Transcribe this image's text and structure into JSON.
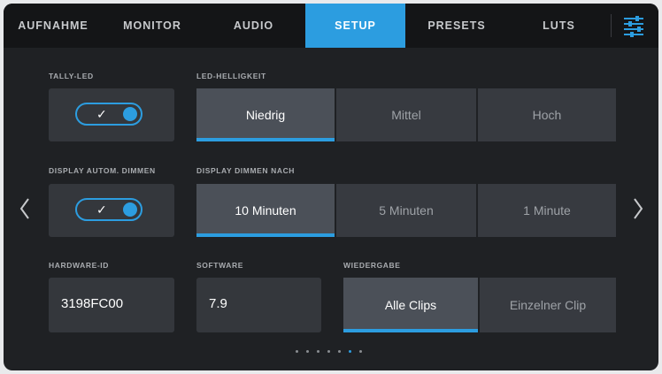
{
  "tabs": [
    {
      "label": "AUFNAHME",
      "active": false
    },
    {
      "label": "MONITOR",
      "active": false
    },
    {
      "label": "AUDIO",
      "active": false
    },
    {
      "label": "SETUP",
      "active": true
    },
    {
      "label": "PRESETS",
      "active": false
    },
    {
      "label": "LUTS",
      "active": false
    }
  ],
  "menu_icon": "sliders-icon",
  "tally_led": {
    "label": "TALLY-LED",
    "enabled": true
  },
  "led_brightness": {
    "label": "LED-HELLIGKEIT",
    "options": [
      "Niedrig",
      "Mittel",
      "Hoch"
    ],
    "selected": "Niedrig"
  },
  "display_auto_dim": {
    "label": "DISPLAY AUTOM. DIMMEN",
    "enabled": true
  },
  "display_dim_after": {
    "label": "DISPLAY DIMMEN NACH",
    "options": [
      "10 Minuten",
      "5 Minuten",
      "1 Minute"
    ],
    "selected": "10 Minuten"
  },
  "hardware_id": {
    "label": "HARDWARE-ID",
    "value": "3198FC00"
  },
  "software": {
    "label": "SOFTWARE",
    "value": "7.9"
  },
  "playback": {
    "label": "WIEDERGABE",
    "options": [
      "Alle Clips",
      "Einzelner Clip"
    ],
    "selected": "Alle Clips"
  },
  "pagination": {
    "total": 7,
    "current": 6
  },
  "colors": {
    "accent": "#2c9de0",
    "background": "#1f2124",
    "tabbar": "#141517"
  }
}
